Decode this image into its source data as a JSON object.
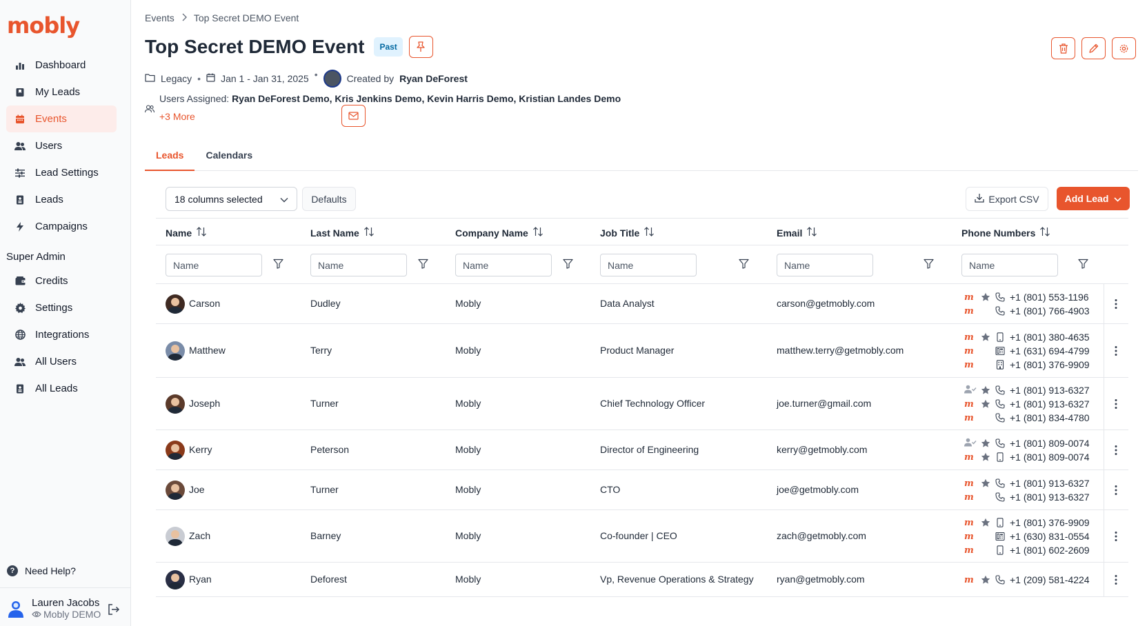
{
  "app": {
    "logo": "mobly",
    "colors": {
      "accent": "#e8552d",
      "badge_bg": "#e0f2fe",
      "badge_text": "#0369a1",
      "active_nav_bg": "#fdecea"
    }
  },
  "sidebar": {
    "items": [
      {
        "label": "Dashboard",
        "icon": "bar-chart-icon"
      },
      {
        "label": "My Leads",
        "icon": "bookmark-icon"
      },
      {
        "label": "Events",
        "icon": "calendar-icon",
        "active": true
      },
      {
        "label": "Users",
        "icon": "users-icon"
      },
      {
        "label": "Lead Settings",
        "icon": "sliders-icon"
      },
      {
        "label": "Leads",
        "icon": "contact-card-icon"
      },
      {
        "label": "Campaigns",
        "icon": "lightning-icon"
      }
    ],
    "section_label": "Super Admin",
    "admin_items": [
      {
        "label": "Credits",
        "icon": "wallet-icon"
      },
      {
        "label": "Settings",
        "icon": "gear-icon"
      },
      {
        "label": "Integrations",
        "icon": "globe-icon"
      },
      {
        "label": "All Users",
        "icon": "users-icon"
      },
      {
        "label": "All Leads",
        "icon": "contact-card-icon"
      }
    ],
    "help_label": "Need Help?",
    "user": {
      "name": "Lauren Jacobs",
      "org": "Mobly DEMO"
    }
  },
  "header": {
    "breadcrumb": [
      "Events",
      "Top Secret DEMO Event"
    ],
    "title": "Top Secret DEMO Event",
    "badge": "Past",
    "folder": "Legacy",
    "date_range": "Jan 1 - Jan 31, 2025",
    "created_by_label": "Created by",
    "created_by": "Ryan DeForest",
    "assigned_label": "Users Assigned:",
    "assigned_users": "Ryan DeForest Demo, Kris Jenkins Demo, Kevin Harris Demo, Kristian Landes Demo",
    "more_label": "+3 More"
  },
  "tabs": [
    {
      "label": "Leads",
      "active": true
    },
    {
      "label": "Calendars",
      "active": false
    }
  ],
  "toolbar": {
    "columns_selected": "18 columns selected",
    "defaults_label": "Defaults",
    "export_label": "Export CSV",
    "add_label": "Add Lead"
  },
  "table": {
    "columns": [
      "Name",
      "Last Name",
      "Company Name",
      "Job Title",
      "Email",
      "Phone Numbers"
    ],
    "filter_placeholder": "Name",
    "rows": [
      {
        "first": "Carson",
        "last": "Dudley",
        "company": "Mobly",
        "title": "Data Analyst",
        "email": "carson@getmobly.com",
        "phones": [
          {
            "src": "m",
            "star": true,
            "type": "phone",
            "number": "+1 (801) 553-1196"
          },
          {
            "src": "m",
            "star": false,
            "type": "phone",
            "number": "+1 (801) 766-4903"
          }
        ]
      },
      {
        "first": "Matthew",
        "last": "Terry",
        "company": "Mobly",
        "title": "Product Manager",
        "email": "matthew.terry@getmobly.com",
        "phones": [
          {
            "src": "m",
            "star": true,
            "type": "mobile",
            "number": "+1 (801) 380-4635"
          },
          {
            "src": "m",
            "star": false,
            "type": "office",
            "number": "+1 (631) 694-4799"
          },
          {
            "src": "m",
            "star": false,
            "type": "building",
            "number": "+1 (801) 376-9909"
          }
        ]
      },
      {
        "first": "Joseph",
        "last": "Turner",
        "company": "Mobly",
        "title": "Chief Technology Officer",
        "email": "joe.turner@gmail.com",
        "phones": [
          {
            "src": "user",
            "star": true,
            "type": "phone",
            "number": "+1 (801) 913-6327"
          },
          {
            "src": "m",
            "star": true,
            "type": "phone",
            "number": "+1 (801) 913-6327"
          },
          {
            "src": "m",
            "star": false,
            "type": "phone",
            "number": "+1 (801) 834-4780"
          }
        ]
      },
      {
        "first": "Kerry",
        "last": "Peterson",
        "company": "Mobly",
        "title": "Director of Engineering",
        "email": "kerry@getmobly.com",
        "phones": [
          {
            "src": "user",
            "star": true,
            "type": "phone",
            "number": "+1 (801) 809-0074"
          },
          {
            "src": "m",
            "star": true,
            "type": "mobile",
            "number": "+1 (801) 809-0074"
          }
        ]
      },
      {
        "first": "Joe",
        "last": "Turner",
        "company": "Mobly",
        "title": "CTO",
        "email": "joe@getmobly.com",
        "phones": [
          {
            "src": "m",
            "star": true,
            "type": "phone",
            "number": "+1 (801) 913-6327"
          },
          {
            "src": "m",
            "star": false,
            "type": "phone",
            "number": "+1 (801) 913-6327"
          }
        ]
      },
      {
        "first": "Zach",
        "last": "Barney",
        "company": "Mobly",
        "title": "Co-founder | CEO",
        "email": "zach@getmobly.com",
        "phones": [
          {
            "src": "m",
            "star": true,
            "type": "mobile",
            "number": "+1 (801) 376-9909"
          },
          {
            "src": "m",
            "star": false,
            "type": "office",
            "number": "+1 (630) 831-0554"
          },
          {
            "src": "m",
            "star": false,
            "type": "mobile",
            "number": "+1 (801) 602-2609"
          }
        ]
      },
      {
        "first": "Ryan",
        "last": "Deforest",
        "company": "Mobly",
        "title": "Vp, Revenue Operations & Strategy",
        "email": "ryan@getmobly.com",
        "phones": [
          {
            "src": "m",
            "star": true,
            "type": "phone",
            "number": "+1 (209) 581-4224"
          }
        ]
      }
    ]
  }
}
